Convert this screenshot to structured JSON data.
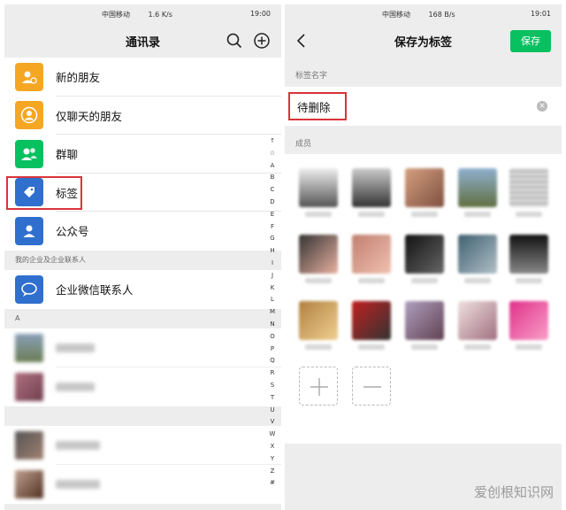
{
  "left": {
    "status": {
      "carrier": "中国移动",
      "speed": "1.6 K/s",
      "battery": "",
      "time": "19:00"
    },
    "title": "通讯录",
    "menu": [
      {
        "label": "新的朋友",
        "color": "#f5a623"
      },
      {
        "label": "仅聊天的朋友",
        "color": "#f5a623"
      },
      {
        "label": "群聊",
        "color": "#07c160"
      },
      {
        "label": "标签",
        "color": "#2f6fce"
      },
      {
        "label": "公众号",
        "color": "#2f6fce"
      }
    ],
    "enterprise_section": "我的企业及企业联系人",
    "enterprise_item": {
      "label": "企业微信联系人",
      "color": "#2f6fce"
    },
    "section_a": "A",
    "alpha_index": [
      "↑",
      "☆",
      "A",
      "B",
      "C",
      "D",
      "E",
      "F",
      "G",
      "H",
      "I",
      "J",
      "K",
      "L",
      "M",
      "N",
      "O",
      "P",
      "Q",
      "R",
      "S",
      "T",
      "U",
      "V",
      "W",
      "X",
      "Y",
      "Z",
      "#"
    ]
  },
  "right": {
    "status": {
      "carrier": "中国移动",
      "speed": "168 B/s",
      "time": "19:01"
    },
    "title": "保存为标签",
    "save_label": "保存",
    "tag_name_label": "标签名字",
    "tag_name_value": "待删除",
    "members_label": "成员"
  },
  "watermark": "爱创根知识网",
  "colors": {
    "accent_green": "#07c160",
    "highlight_red": "#d9343a"
  }
}
